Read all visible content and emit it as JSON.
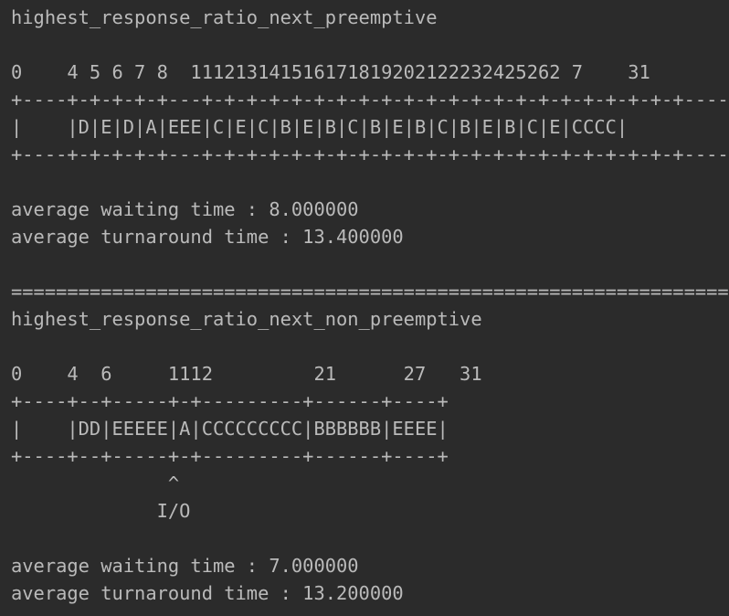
{
  "terminal": {
    "background": "#2b2b2b",
    "text_color": "#bababa",
    "lines": [
      "highest_response_ratio_next_preemptive",
      "",
      "0    4 5 6 7 8  111213141516171819202122232425262 7    31",
      "+----+-+-+-+-+---+-+-+-+-+-+-+-+-+-+-+-+-+-+-+-+-+-+-+-+-+-+----+",
      "|    |D|E|D|A|EEE|C|E|C|B|E|B|C|B|E|B|C|B|E|B|C|E|CCCC|",
      "+----+-+-+-+-+---+-+-+-+-+-+-+-+-+-+-+-+-+-+-+-+-+-+-+-+-+-+----+",
      "",
      "average waiting time : 8.000000",
      "average turnaround time : 13.400000",
      "",
      "==========================================================================",
      "highest_response_ratio_next_non_preemptive",
      "",
      "0    4  6     1112         21      27   31",
      "+----+--+-----+-+---------+------+----+",
      "|    |DD|EEEEE|A|CCCCCCCCC|BBBBBB|EEEE|",
      "+----+--+-----+-+---------+------+----+",
      "              ^",
      "             I/O",
      "",
      "average waiting time : 7.000000",
      "average turnaround time : 13.200000"
    ]
  }
}
